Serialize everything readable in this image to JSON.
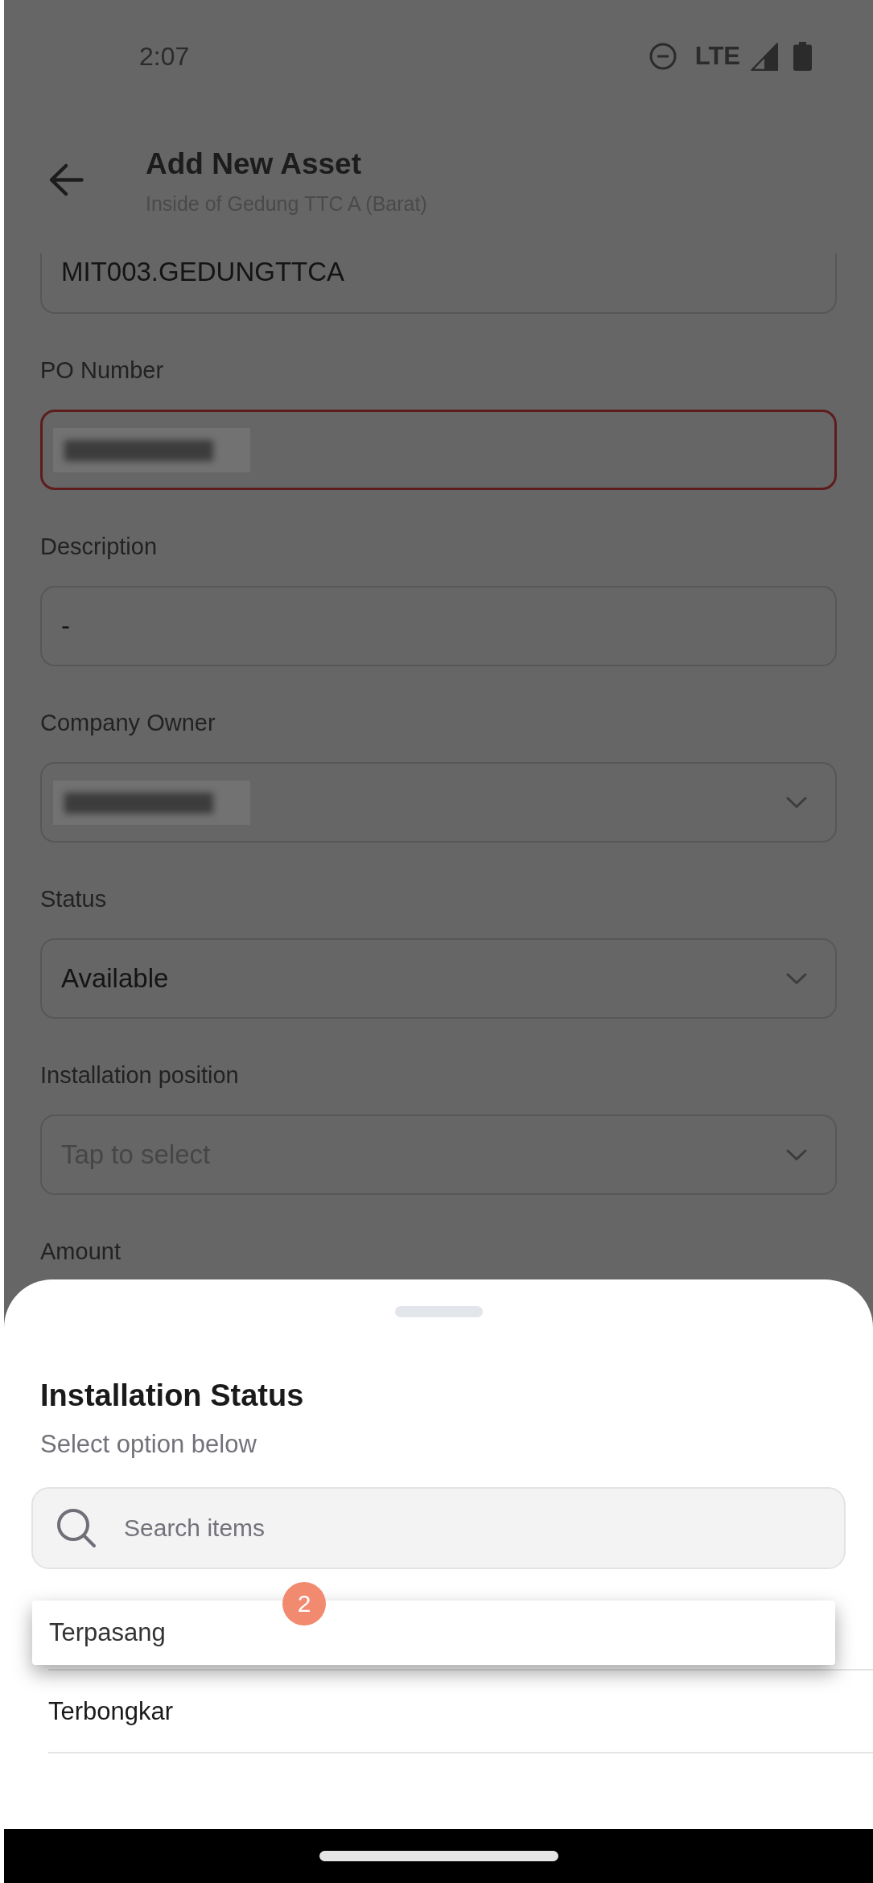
{
  "status_bar": {
    "time": "2:07",
    "network": "LTE"
  },
  "header": {
    "title": "Add New Asset",
    "subtitle": "Inside of Gedung TTC A (Barat)"
  },
  "form": {
    "scrolled_field": {
      "value": "MIT003.GEDUNGTTCA"
    },
    "fields": [
      {
        "kind": "text",
        "label": "PO Number",
        "value_blurred": true,
        "error": true
      },
      {
        "kind": "text",
        "label": "Description",
        "value": "-",
        "value_blurred": false,
        "error": false
      },
      {
        "kind": "dropdown",
        "label": "Company Owner",
        "value_blurred": true,
        "error": false
      },
      {
        "kind": "dropdown",
        "label": "Status",
        "value": "Available",
        "value_blurred": false,
        "error": false
      },
      {
        "kind": "dropdown",
        "label": "Installation position",
        "placeholder": "Tap to select",
        "value_blurred": false,
        "error": false
      }
    ],
    "covered_field": {
      "label": "Amount"
    }
  },
  "sheet": {
    "title": "Installation Status",
    "subtitle": "Select option below",
    "search": {
      "placeholder": "Search items"
    },
    "options": [
      {
        "label": "Terpasang",
        "selected": true
      },
      {
        "label": "Terbongkar",
        "selected": false
      }
    ]
  },
  "touch_marker": {
    "label": "2"
  }
}
